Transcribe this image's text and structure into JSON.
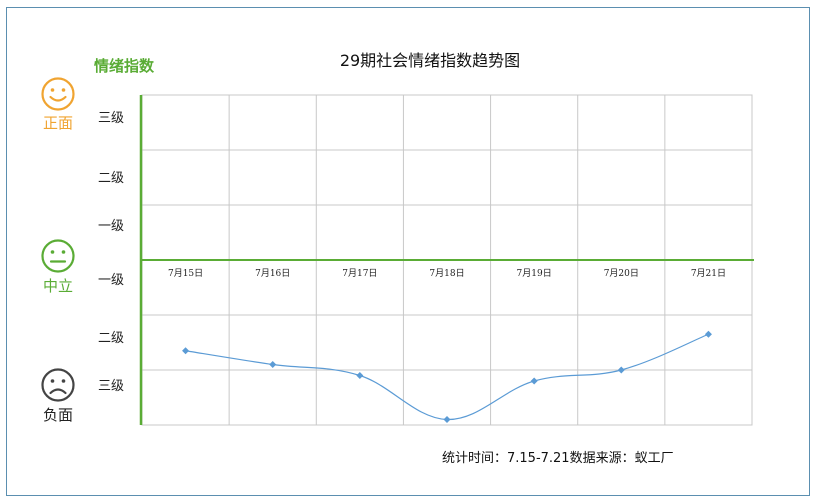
{
  "title": "29期社会情绪指数趋势图",
  "y_axis_title": "情绪指数",
  "levels_positive": [
    "三级",
    "二级",
    "一级"
  ],
  "levels_negative": [
    "一级",
    "二级",
    "三级"
  ],
  "faces": {
    "positive": {
      "label": "正面",
      "color": "#f0a431",
      "icon": "smile-face-icon"
    },
    "neutral": {
      "label": "中立",
      "color": "#5aac35",
      "icon": "neutral-face-icon"
    },
    "negative": {
      "label": "负面",
      "color": "#444444",
      "icon": "sad-face-icon"
    }
  },
  "footer": "统计时间：7.15-7.21数据来源：蚁工厂",
  "colors": {
    "line": "#5b9bd5",
    "axis": "#5aac35",
    "grid": "#c8c8c8",
    "frame": "#5b8fb0"
  },
  "chart_data": {
    "type": "line",
    "categories": [
      "7月15日",
      "7月16日",
      "7月17日",
      "7月18日",
      "7月19日",
      "7月20日",
      "7月21日"
    ],
    "values": [
      -1.65,
      -1.9,
      -2.1,
      -2.9,
      -2.2,
      -2.0,
      -1.35
    ],
    "ylim": [
      -3,
      3
    ],
    "grid": true,
    "smooth": true
  }
}
